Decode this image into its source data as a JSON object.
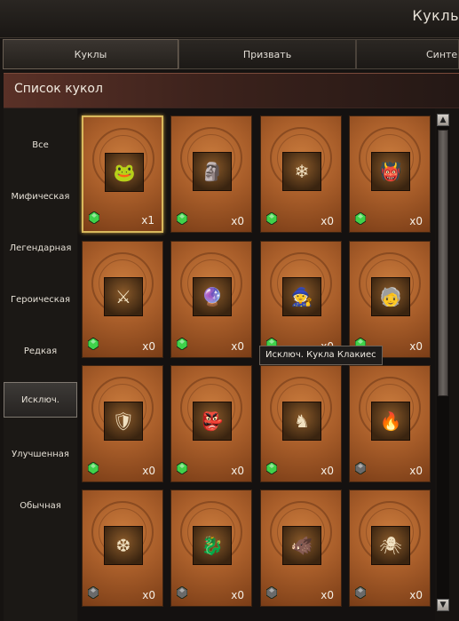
{
  "window": {
    "title": "Кукль"
  },
  "tabs": [
    {
      "label": "Куклы",
      "active": true
    },
    {
      "label": "Призвать",
      "active": false
    },
    {
      "label": "Синтез",
      "active": false
    }
  ],
  "list_header": {
    "title": "Список кукол"
  },
  "categories": [
    {
      "label": "Все",
      "active": false
    },
    {
      "label": "Мифическая",
      "active": false
    },
    {
      "label": "Легендарная",
      "active": false
    },
    {
      "label": "Героическая",
      "active": false
    },
    {
      "label": "Редкая",
      "active": false
    },
    {
      "label": "Исключ.",
      "active": true
    },
    {
      "label": "Улучшенная",
      "active": false
    },
    {
      "label": "Обычная",
      "active": false
    }
  ],
  "cards": [
    {
      "icon": "frog-doll-icon",
      "count": "x1",
      "gem": "green",
      "selected": true
    },
    {
      "icon": "stone-golem-doll-icon",
      "count": "x0",
      "gem": "green"
    },
    {
      "icon": "ice-crystal-doll-icon",
      "count": "x0",
      "gem": "green"
    },
    {
      "icon": "red-demon-doll-icon",
      "count": "x0",
      "gem": "green"
    },
    {
      "icon": "white-haired-warrior-doll-icon",
      "count": "x0",
      "gem": "green"
    },
    {
      "icon": "crystal-orb-doll-icon",
      "count": "x0",
      "gem": "green"
    },
    {
      "icon": "witch-doll-icon",
      "count": "x0",
      "gem": "green"
    },
    {
      "icon": "old-sage-doll-icon",
      "count": "x0",
      "gem": "green"
    },
    {
      "icon": "armored-knight-doll-icon",
      "count": "x0",
      "gem": "green"
    },
    {
      "icon": "masked-shaman-doll-icon",
      "count": "x0",
      "gem": "green"
    },
    {
      "icon": "dark-knight-doll-icon",
      "count": "x0",
      "gem": "green"
    },
    {
      "icon": "fire-spirit-doll-icon",
      "count": "x0",
      "gem": "gray"
    },
    {
      "icon": "ice-beast-doll-icon",
      "count": "x0",
      "gem": "gray"
    },
    {
      "icon": "sea-creature-doll-icon",
      "count": "x0",
      "gem": "gray"
    },
    {
      "icon": "horned-beast-doll-icon",
      "count": "x0",
      "gem": "gray"
    },
    {
      "icon": "skull-spider-doll-icon",
      "count": "x0",
      "gem": "gray"
    }
  ],
  "tooltip": {
    "text": "Исключ. Кукла Клакиес"
  },
  "colors": {
    "gem_green": "#3fd24a",
    "gem_gray": "#6a6a6a",
    "card_bg": "#a95e2a",
    "selected_border": "#d8b85c"
  }
}
